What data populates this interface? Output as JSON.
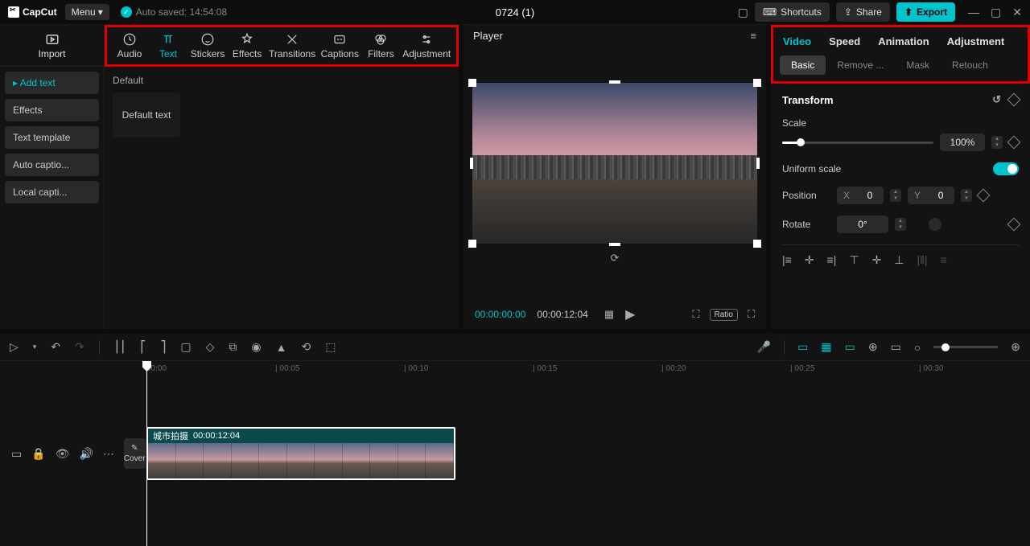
{
  "app": {
    "name": "CapCut",
    "menu": "Menu",
    "autosave": "Auto saved: 14:54:08",
    "projectTitle": "0724 (1)"
  },
  "topbar": {
    "shortcuts": "Shortcuts",
    "share": "Share",
    "export": "Export"
  },
  "import": {
    "label": "Import"
  },
  "toolTabs": {
    "audio": "Audio",
    "text": "Text",
    "stickers": "Stickers",
    "effects": "Effects",
    "transitions": "Transitions",
    "captions": "Captions",
    "filters": "Filters",
    "adjustment": "Adjustment"
  },
  "leftList": {
    "addText": "Add text",
    "effects": "Effects",
    "textTemplate": "Text template",
    "autoCaptions": "Auto captio...",
    "localCaptions": "Local capti..."
  },
  "assets": {
    "defaultLabel": "Default",
    "defaultText": "Default text"
  },
  "player": {
    "title": "Player",
    "currentTime": "00:00:00:00",
    "totalTime": "00:00:12:04",
    "ratio": "Ratio"
  },
  "inspector": {
    "tabs": {
      "video": "Video",
      "speed": "Speed",
      "animation": "Animation",
      "adjustment": "Adjustment"
    },
    "subtabs": {
      "basic": "Basic",
      "remove": "Remove ...",
      "mask": "Mask",
      "retouch": "Retouch"
    },
    "transform": "Transform",
    "scale": {
      "label": "Scale",
      "value": "100%"
    },
    "uniformScale": "Uniform scale",
    "position": {
      "label": "Position",
      "xLabel": "X",
      "xVal": "0",
      "yLabel": "Y",
      "yVal": "0"
    },
    "rotate": {
      "label": "Rotate",
      "value": "0°"
    }
  },
  "timeline": {
    "marks": [
      "00:00",
      "| 00:05",
      "| 00:10",
      "| 00:15",
      "| 00:20",
      "| 00:25",
      "| 00:30"
    ],
    "clip": {
      "name": "城市拍摄",
      "duration": "00:00:12:04"
    },
    "cover": "Cover"
  }
}
